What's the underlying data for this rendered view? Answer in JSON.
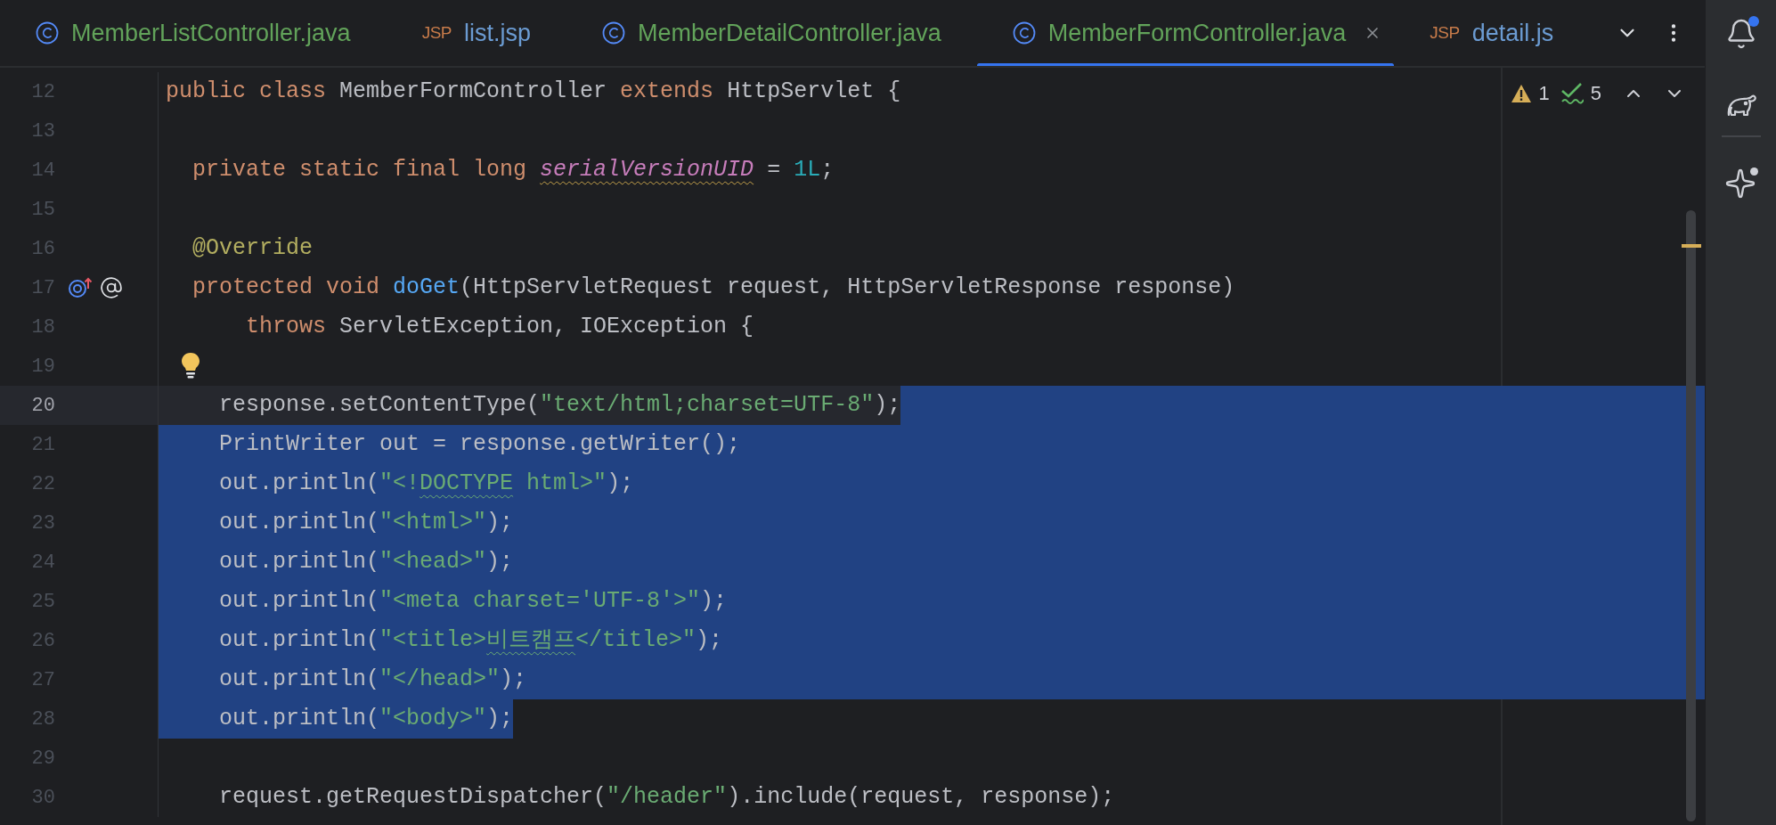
{
  "tabs": [
    {
      "kind": "java",
      "label": "MemberListController.java",
      "selected": false
    },
    {
      "kind": "jsp",
      "badge": "JSP",
      "label": "list.jsp",
      "selected": false
    },
    {
      "kind": "java",
      "label": "MemberDetailController.java",
      "selected": false
    },
    {
      "kind": "java",
      "label": "MemberFormController.java",
      "selected": true
    },
    {
      "kind": "jsp",
      "badge": "JSP",
      "label": "detail.js",
      "selected": false
    }
  ],
  "inspections": [
    {
      "kind": "warning",
      "count": "1"
    },
    {
      "kind": "weak",
      "count": "5"
    }
  ],
  "lines": [
    {
      "number": "12",
      "current": false,
      "selected": false,
      "tokens": [
        {
          "kind": "keyword",
          "text": "public class "
        },
        {
          "kind": "plain",
          "text": "MemberFormController "
        },
        {
          "kind": "keyword",
          "text": "extends "
        },
        {
          "kind": "plain",
          "text": "HttpServlet {"
        }
      ]
    },
    {
      "number": "13",
      "current": false,
      "selected": false
    },
    {
      "number": "14",
      "current": false,
      "selected": false,
      "tokens": [
        {
          "kind": "keyword",
          "text": "  private static final long "
        },
        {
          "kind": "field",
          "text": "serialVersionUID",
          "squiggle": true
        },
        {
          "kind": "plain",
          "text": " = "
        },
        {
          "kind": "number",
          "text": "1L"
        },
        {
          "kind": "plain",
          "text": ";"
        }
      ]
    },
    {
      "number": "15",
      "current": false,
      "selected": false
    },
    {
      "number": "16",
      "current": false,
      "selected": false,
      "tokens": [
        {
          "kind": "annotation",
          "text": "  @Override"
        }
      ]
    },
    {
      "number": "17",
      "current": false,
      "selected": false,
      "gutter_icons": [
        {
          "kind": "override"
        },
        {
          "kind": "annotated"
        }
      ],
      "tokens": [
        {
          "kind": "keyword",
          "text": "  protected void "
        },
        {
          "kind": "method",
          "text": "doGet"
        },
        {
          "kind": "plain",
          "text": "(HttpServletRequest request, HttpServletResponse response)"
        }
      ]
    },
    {
      "number": "18",
      "current": false,
      "selected": false,
      "tokens": [
        {
          "kind": "keyword",
          "text": "      throws "
        },
        {
          "kind": "plain",
          "text": "ServletException, IOException {"
        }
      ]
    },
    {
      "number": "19",
      "current": false,
      "selected": false,
      "bulb": true
    },
    {
      "number": "20",
      "current": true,
      "selected": true,
      "tokens": [
        {
          "kind": "plain",
          "text": "    response.setContentType("
        },
        {
          "kind": "string",
          "text": "\"text/html;charset=UTF-8\""
        },
        {
          "kind": "plain",
          "text": ");"
        }
      ]
    },
    {
      "number": "21",
      "current": false,
      "selected": true,
      "tokens": [
        {
          "kind": "plain",
          "text": "    PrintWriter out = response.getWriter();"
        }
      ]
    },
    {
      "number": "22",
      "current": false,
      "selected": true,
      "tokens": [
        {
          "kind": "plain",
          "text": "    out.println("
        },
        {
          "kind": "string",
          "text": "\"<!"
        },
        {
          "kind": "string",
          "text": "DOCTYPE",
          "squiggle": true
        },
        {
          "kind": "string",
          "text": " html>\""
        },
        {
          "kind": "plain",
          "text": ");"
        }
      ]
    },
    {
      "number": "23",
      "current": false,
      "selected": true,
      "tokens": [
        {
          "kind": "plain",
          "text": "    out.println("
        },
        {
          "kind": "string",
          "text": "\"<html>\""
        },
        {
          "kind": "plain",
          "text": ");"
        }
      ]
    },
    {
      "number": "24",
      "current": false,
      "selected": true,
      "tokens": [
        {
          "kind": "plain",
          "text": "    out.println("
        },
        {
          "kind": "string",
          "text": "\"<head>\""
        },
        {
          "kind": "plain",
          "text": ");"
        }
      ]
    },
    {
      "number": "25",
      "current": false,
      "selected": true,
      "tokens": [
        {
          "kind": "plain",
          "text": "    out.println("
        },
        {
          "kind": "string",
          "text": "\"<meta charset='UTF-8'>\""
        },
        {
          "kind": "plain",
          "text": ");"
        }
      ]
    },
    {
      "number": "26",
      "current": false,
      "selected": true,
      "tokens": [
        {
          "kind": "plain",
          "text": "    out.println("
        },
        {
          "kind": "string",
          "text": "\"<title>"
        },
        {
          "kind": "string",
          "text": "비트캠프",
          "squiggle": true
        },
        {
          "kind": "string",
          "text": "</title>\""
        },
        {
          "kind": "plain",
          "text": ");"
        }
      ]
    },
    {
      "number": "27",
      "current": false,
      "selected": true,
      "tokens": [
        {
          "kind": "plain",
          "text": "    out.println("
        },
        {
          "kind": "string",
          "text": "\"</head>\""
        },
        {
          "kind": "plain",
          "text": ");"
        }
      ]
    },
    {
      "number": "28",
      "current": false,
      "selected": true,
      "tokens": [
        {
          "kind": "plain",
          "text": "    out.println("
        },
        {
          "kind": "string",
          "text": "\"<body>\""
        },
        {
          "kind": "plain",
          "text": ");"
        }
      ]
    },
    {
      "number": "29",
      "current": false,
      "selected": false
    },
    {
      "number": "30",
      "current": false,
      "selected": false,
      "tokens": [
        {
          "kind": "plain",
          "text": "    request.getRequestDispatcher("
        },
        {
          "kind": "string",
          "text": "\"/header\""
        },
        {
          "kind": "plain",
          "text": ").include(request, response);"
        }
      ]
    }
  ]
}
